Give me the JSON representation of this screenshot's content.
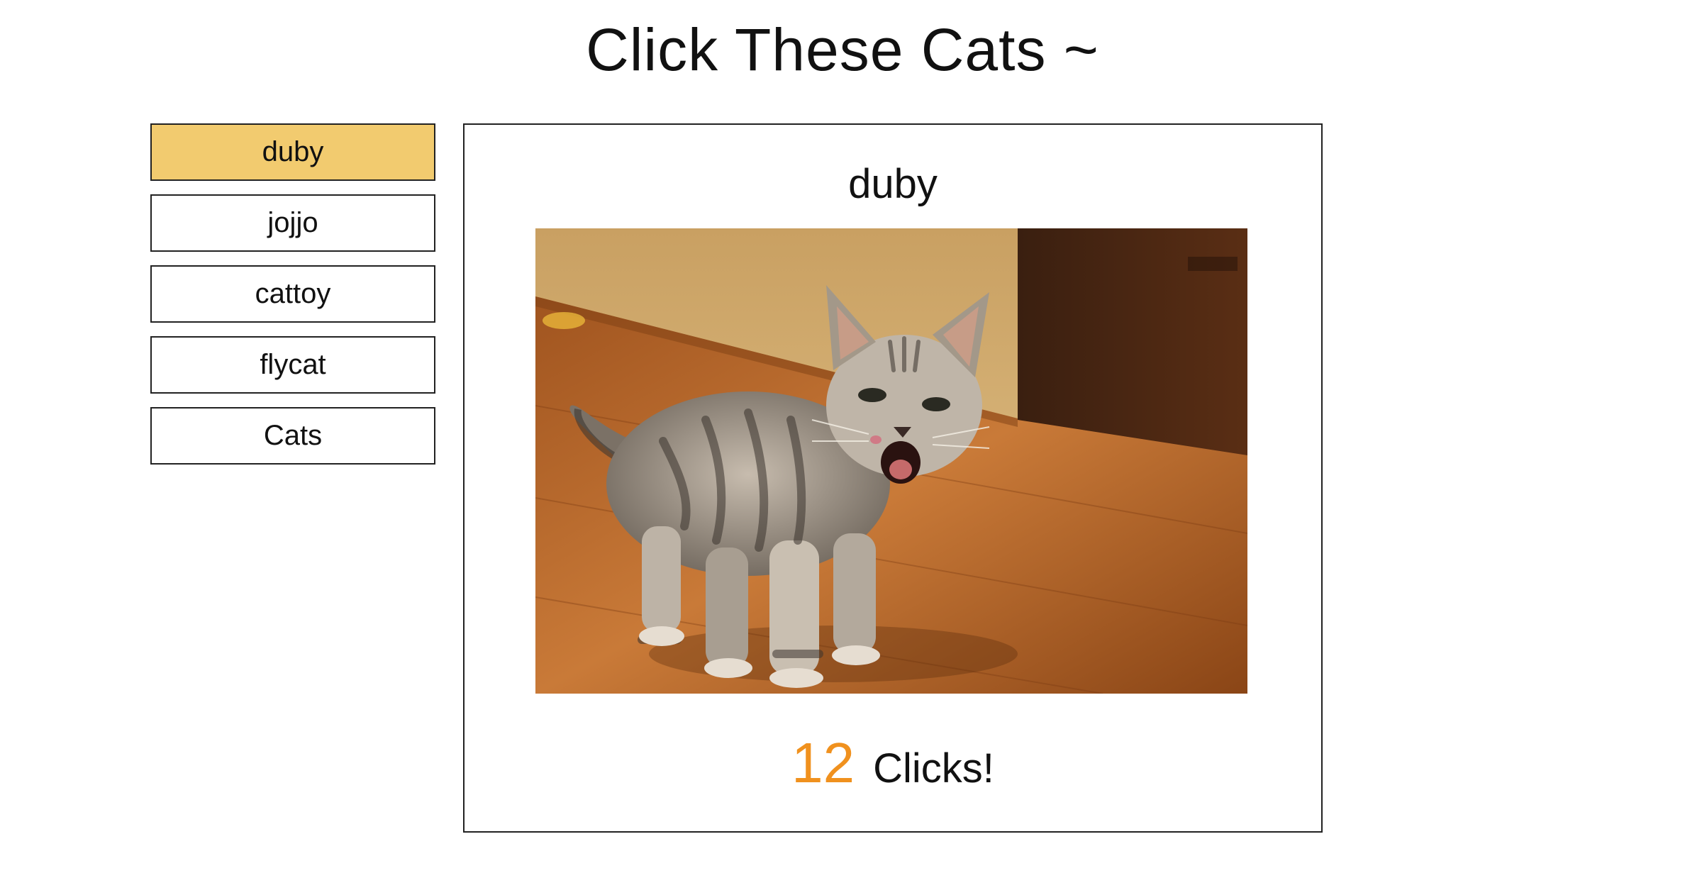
{
  "page": {
    "title": "Click These Cats ~"
  },
  "cats": [
    {
      "name": "duby",
      "active": true
    },
    {
      "name": "jojjo",
      "active": false
    },
    {
      "name": "cattoy",
      "active": false
    },
    {
      "name": "flycat",
      "active": false
    },
    {
      "name": "Cats",
      "active": false
    }
  ],
  "viewer": {
    "name": "duby",
    "image_alt": "duby",
    "click_count": "12",
    "click_suffix": "Clicks!"
  },
  "colors": {
    "active_item_bg": "#f2cb6f",
    "count_color": "#f0911e",
    "border": "#222222"
  }
}
